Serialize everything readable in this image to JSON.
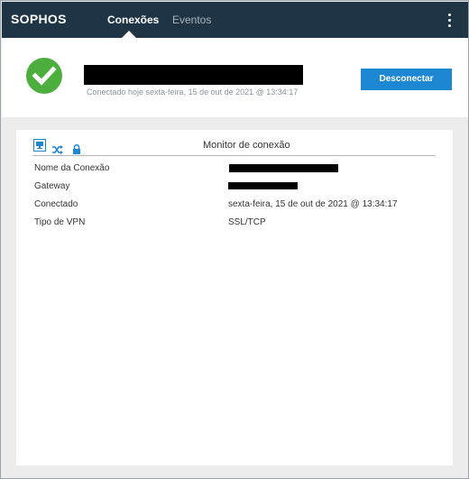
{
  "app": {
    "logo": "SOPHOS",
    "tabs": [
      {
        "label": "Conexões",
        "active": true
      },
      {
        "label": "Eventos",
        "active": false
      }
    ]
  },
  "header": {
    "status": "connected",
    "connected_since": "Conectado hoje sexta-feira, 15 de out de 2021 @ 13:34:17",
    "disconnect_label": "Desconectar"
  },
  "monitor": {
    "title": "Monitor de conexão",
    "icons": [
      "monitor-icon",
      "shuffle-icon",
      "lock-icon"
    ],
    "rows": [
      {
        "label": "Nome da Conexão",
        "value": ""
      },
      {
        "label": "Gateway",
        "value": ""
      },
      {
        "label": "Conectado",
        "value": "sexta-feira, 15 de out de 2021 @ 13:34:17"
      },
      {
        "label": "Tipo de VPN",
        "value": "SSL/TCP"
      }
    ]
  },
  "colors": {
    "topbar": "#1f3545",
    "accent": "#1e87d3",
    "success": "#4caf3d"
  }
}
